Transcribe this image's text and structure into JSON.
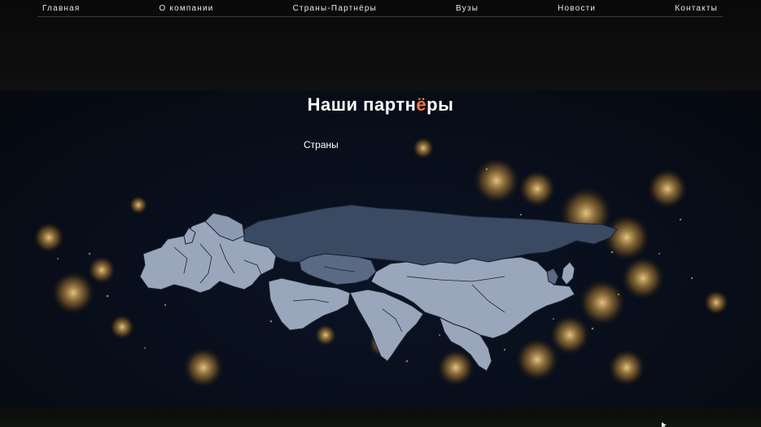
{
  "nav": {
    "items": [
      {
        "label": "Главная"
      },
      {
        "label": "О компании"
      },
      {
        "label": "Страны-Партнёры"
      },
      {
        "label": "Вузы"
      },
      {
        "label": "Новости"
      },
      {
        "label": "Контакты"
      }
    ]
  },
  "hero": {
    "title_prefix": "Наши партн",
    "title_accent": "ё",
    "title_suffix": "ры",
    "countries_label": "Страны"
  },
  "colors": {
    "accent": "#f07b3c",
    "map_land": "#9aa6bc",
    "map_land_dark": "#3a4a63",
    "city_lights": "#f3c46b"
  }
}
